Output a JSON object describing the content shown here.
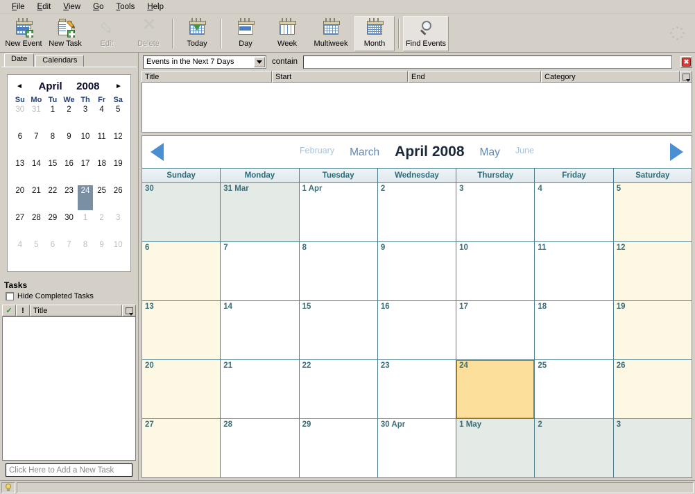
{
  "menu": {
    "items": [
      {
        "label": "File",
        "mnemonic": "F"
      },
      {
        "label": "Edit",
        "mnemonic": "E"
      },
      {
        "label": "View",
        "mnemonic": "V"
      },
      {
        "label": "Go",
        "mnemonic": "G"
      },
      {
        "label": "Tools",
        "mnemonic": "T"
      },
      {
        "label": "Help",
        "mnemonic": "H"
      }
    ]
  },
  "toolbar": {
    "new_event": "New Event",
    "new_task": "New Task",
    "edit": "Edit",
    "delete": "Delete",
    "today": "Today",
    "day": "Day",
    "week": "Week",
    "multiweek": "Multiweek",
    "month": "Month",
    "find_events": "Find Events"
  },
  "sidebar": {
    "tabs": [
      {
        "label": "Date",
        "active": true
      },
      {
        "label": "Calendars",
        "active": false
      }
    ],
    "minical": {
      "prev_arrow": "◄",
      "next_arrow": "►",
      "month": "April",
      "year": "2008",
      "dow": [
        "Su",
        "Mo",
        "Tu",
        "We",
        "Th",
        "Fr",
        "Sa"
      ],
      "weeks": [
        [
          {
            "d": "30",
            "dim": true
          },
          {
            "d": "31",
            "dim": true
          },
          {
            "d": "1"
          },
          {
            "d": "2"
          },
          {
            "d": "3"
          },
          {
            "d": "4"
          },
          {
            "d": "5"
          }
        ],
        [
          {
            "d": "6"
          },
          {
            "d": "7"
          },
          {
            "d": "8"
          },
          {
            "d": "9"
          },
          {
            "d": "10"
          },
          {
            "d": "11"
          },
          {
            "d": "12"
          }
        ],
        [
          {
            "d": "13"
          },
          {
            "d": "14"
          },
          {
            "d": "15"
          },
          {
            "d": "16"
          },
          {
            "d": "17"
          },
          {
            "d": "18"
          },
          {
            "d": "19"
          }
        ],
        [
          {
            "d": "20"
          },
          {
            "d": "21"
          },
          {
            "d": "22"
          },
          {
            "d": "23"
          },
          {
            "d": "24",
            "sel": true
          },
          {
            "d": "25"
          },
          {
            "d": "26"
          }
        ],
        [
          {
            "d": "27"
          },
          {
            "d": "28"
          },
          {
            "d": "29"
          },
          {
            "d": "30"
          },
          {
            "d": "1",
            "dim": true
          },
          {
            "d": "2",
            "dim": true
          },
          {
            "d": "3",
            "dim": true
          }
        ],
        [
          {
            "d": "4",
            "dim": true
          },
          {
            "d": "5",
            "dim": true
          },
          {
            "d": "6",
            "dim": true
          },
          {
            "d": "7",
            "dim": true
          },
          {
            "d": "8",
            "dim": true
          },
          {
            "d": "9",
            "dim": true
          },
          {
            "d": "10",
            "dim": true
          }
        ]
      ]
    },
    "tasks": {
      "title": "Tasks",
      "hide_completed_label": "Hide Completed Tasks",
      "hide_completed_checked": false,
      "columns": {
        "done": "✓",
        "priority": "!",
        "title": "Title",
        "chooser": "columns-icon"
      },
      "new_task_placeholder": "Click Here to Add a New Task"
    }
  },
  "search": {
    "filter_value": "Events in the Next 7 Days",
    "filter_options": [
      "Events in the Next 7 Days"
    ],
    "contain_label": "contain",
    "query_value": "",
    "close_label": "✖"
  },
  "event_list": {
    "columns": [
      "Title",
      "Start",
      "End",
      "Category"
    ],
    "rows": []
  },
  "calendar": {
    "nav": {
      "prev": "◄",
      "next": "►",
      "months": [
        {
          "label": "February",
          "style": "far"
        },
        {
          "label": "March",
          "style": "near"
        },
        {
          "label": "April 2008",
          "style": "cur"
        },
        {
          "label": "May",
          "style": "near"
        },
        {
          "label": "June",
          "style": "far"
        }
      ]
    },
    "dow": [
      "Sunday",
      "Monday",
      "Tuesday",
      "Wednesday",
      "Thursday",
      "Friday",
      "Saturday"
    ],
    "weeks": [
      [
        {
          "label": "30",
          "offmonth": true
        },
        {
          "label": "31 Mar",
          "offmonth": true
        },
        {
          "label": "1 Apr"
        },
        {
          "label": "2"
        },
        {
          "label": "3"
        },
        {
          "label": "4"
        },
        {
          "label": "5",
          "weekend": true
        }
      ],
      [
        {
          "label": "6",
          "weekend": true
        },
        {
          "label": "7"
        },
        {
          "label": "8"
        },
        {
          "label": "9"
        },
        {
          "label": "10"
        },
        {
          "label": "11"
        },
        {
          "label": "12",
          "weekend": true
        }
      ],
      [
        {
          "label": "13",
          "weekend": true
        },
        {
          "label": "14"
        },
        {
          "label": "15"
        },
        {
          "label": "16"
        },
        {
          "label": "17"
        },
        {
          "label": "18"
        },
        {
          "label": "19",
          "weekend": true
        }
      ],
      [
        {
          "label": "20",
          "weekend": true
        },
        {
          "label": "21"
        },
        {
          "label": "22"
        },
        {
          "label": "23"
        },
        {
          "label": "24",
          "today": true
        },
        {
          "label": "25"
        },
        {
          "label": "26",
          "weekend": true
        }
      ],
      [
        {
          "label": "27",
          "weekend": true
        },
        {
          "label": "28"
        },
        {
          "label": "29"
        },
        {
          "label": "30 Apr"
        },
        {
          "label": "1 May",
          "offmonth": true
        },
        {
          "label": "2",
          "offmonth": true
        },
        {
          "label": "3",
          "offmonth": true
        }
      ]
    ]
  },
  "statusbar": {
    "icon": "lightbulb-icon",
    "message": ""
  },
  "colors": {
    "chrome": "#d4d0c8",
    "grid_line": "#4e8091",
    "today": "#fbdf9a",
    "weekend": "#fdf8e4",
    "offmonth": "#e4eae6",
    "minical_selection": "#7b8fa3",
    "month_current": "#1b2a3a",
    "month_near": "#5d88b5",
    "month_far": "#a8c4dd",
    "nav_arrow": "#4a8fd1"
  }
}
